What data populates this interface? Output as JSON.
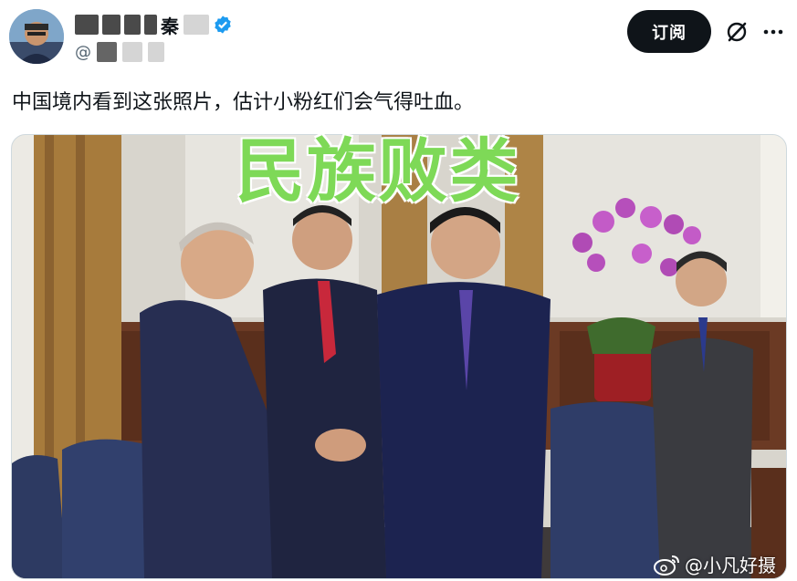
{
  "header": {
    "display_name_visible": "秦",
    "handle_prefix": "@",
    "subscribe_label": "订阅"
  },
  "post": {
    "text": "中国境内看到这张照片，估计小粉红们会气得吐血。"
  },
  "image": {
    "overlay_title": "民族败类",
    "overlay_color": "#7ed957",
    "watermark": "@小凡好摄"
  },
  "icons": {
    "verified": "verified-badge-icon",
    "grok": "grok-icon",
    "more": "more-icon",
    "weibo": "weibo-icon"
  },
  "colors": {
    "accent": "#1d9bf0",
    "button_bg": "#0f1419"
  }
}
